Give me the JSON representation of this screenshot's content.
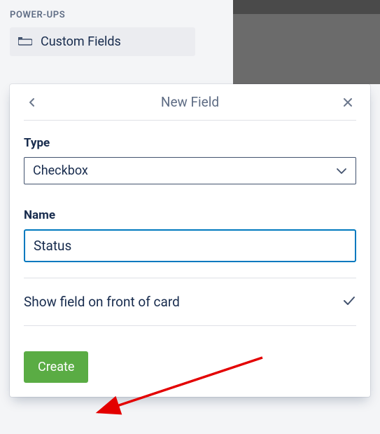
{
  "sidebar": {
    "section_heading": "POWER-UPS",
    "custom_fields_label": "Custom Fields"
  },
  "popup": {
    "title": "New Field",
    "type_label": "Type",
    "type_value": "Checkbox",
    "name_label": "Name",
    "name_value": "Status",
    "toggle_label": "Show field on front of card",
    "create_label": "Create"
  }
}
